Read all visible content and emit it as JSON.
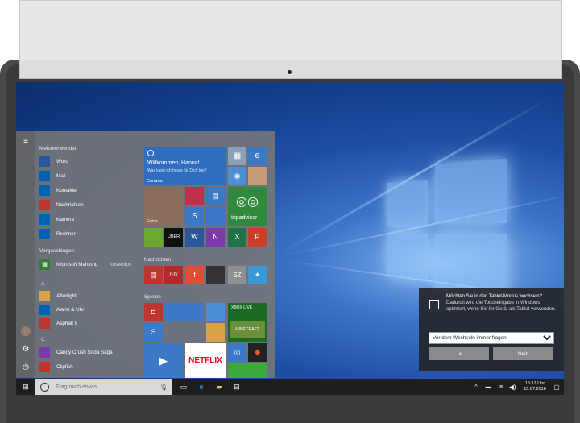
{
  "start_menu": {
    "most_used_header": "Meistverwendet",
    "most_used": [
      {
        "label": "Word",
        "icon": "word-icon",
        "color": "#2b579a"
      },
      {
        "label": "Mail",
        "icon": "mail-icon",
        "color": "#0063b1"
      },
      {
        "label": "Kontakte",
        "icon": "contacts-icon",
        "color": "#0063b1"
      },
      {
        "label": "Nachrichten",
        "icon": "news-icon",
        "color": "#c1352f"
      },
      {
        "label": "Kamera",
        "icon": "camera-icon",
        "color": "#0063b1"
      },
      {
        "label": "Rechner",
        "icon": "calculator-icon",
        "color": "#0063b1"
      }
    ],
    "suggested_header": "Vorgeschlagen",
    "suggested": {
      "label": "Microsoft Mahjong",
      "badge": "Kostenlos"
    },
    "letter_a": "A",
    "apps_a": [
      {
        "label": "Afterlight",
        "icon": "afterlight-icon",
        "color": "#d6a24a"
      },
      {
        "label": "Alarm & Uhr",
        "icon": "alarm-icon",
        "color": "#0063b1"
      },
      {
        "label": "Asphalt 8",
        "icon": "asphalt-icon",
        "color": "#b5392e"
      }
    ],
    "letter_c": "C",
    "apps_c": [
      {
        "label": "Candy Crush Soda Saga",
        "icon": "candy-crush-icon",
        "color": "#7a3aa8"
      },
      {
        "label": "Clipfish",
        "icon": "clipfish-icon",
        "color": "#c8302b"
      }
    ],
    "cortana_tile": {
      "greeting": "Willkommen, Hanna!",
      "sub": "Was kann ich heute für Dich tun?",
      "name": "Cortana"
    },
    "group_news": "Nachrichten",
    "group_games": "Spielen",
    "tile_labels": {
      "photos": "Fotos",
      "uber": "UBER",
      "tripadvisor": "tripadvisor",
      "ntv": "n-tv",
      "sz": "SZ",
      "xbox": "XBOX LIVE",
      "minecraft": "MINECRAFT",
      "netflix": "NETFLIX"
    }
  },
  "taskbar": {
    "search_placeholder": "Frag mich etwas",
    "time": "15:17 Uhr",
    "date": "15.07.2016"
  },
  "toast": {
    "title": "Möchten Sie in den Tablet-Modus wechseln?",
    "body": "Dadurch wird die Toucheingabe in Windows optimiert, wenn Sie Ihr Gerät als Tablet verwenden.",
    "select_value": "Vor dem Wechseln immer fragen",
    "yes": "Ja",
    "no": "Nein"
  }
}
